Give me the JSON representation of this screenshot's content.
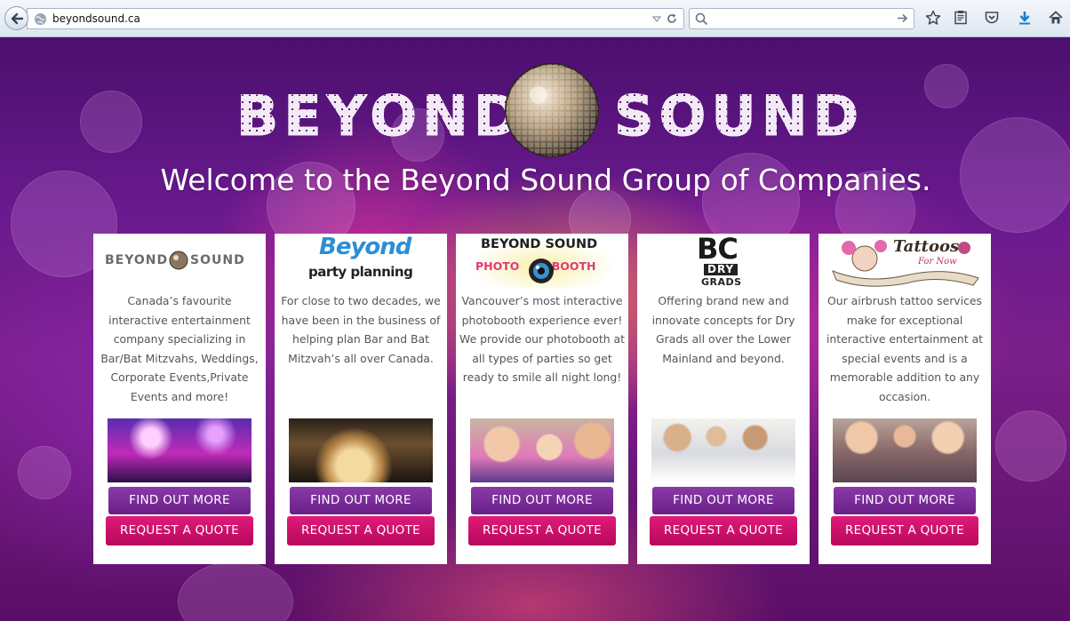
{
  "browser": {
    "url": "beyondsound.ca",
    "search_placeholder": ""
  },
  "page": {
    "logo_left": "BEYOND",
    "logo_right": "SOUND",
    "welcome": "Welcome to the Beyond Sound Group of Companies."
  },
  "cards": [
    {
      "brand_line1": "BEYOND",
      "brand_line2": "SOUND",
      "description": "Canada’s favourite interactive entertainment company specializing in Bar/Bat Mitzvahs, Weddings, Corporate Events,Private Events and more!",
      "more_label": "FIND OUT MORE",
      "quote_label": "REQUEST A QUOTE"
    },
    {
      "brand_line1": "Beyond",
      "brand_line2": "party planning",
      "description": "For close to two decades, we have been in the business of helping plan Bar and Bat Mitzvah’s all over Canada.",
      "more_label": "FIND OUT MORE",
      "quote_label": "REQUEST A QUOTE"
    },
    {
      "brand_line1": "BEYOND SOUND",
      "brand_line2": "PHOTO BOOTH",
      "description": "Vancouver’s most interactive photobooth experience ever! We provide our photobooth at all types of parties so get ready to smile all night long!",
      "more_label": "FIND OUT MORE",
      "quote_label": "REQUEST A QUOTE"
    },
    {
      "brand_line1": "BC",
      "brand_line2": "DRY",
      "brand_line3": "GRADS",
      "description": "Offering brand new and innovate concepts for Dry Grads all over the Lower Mainland and beyond.",
      "more_label": "FIND OUT MORE",
      "quote_label": "REQUEST A QUOTE"
    },
    {
      "brand_line1": "Tattoos",
      "brand_line2": "For Now",
      "description": "Our airbrush tattoo services make for exceptional interactive entertainment at special events and is a memorable addition to any occasion.",
      "more_label": "FIND OUT MORE",
      "quote_label": "REQUEST A QUOTE"
    }
  ]
}
